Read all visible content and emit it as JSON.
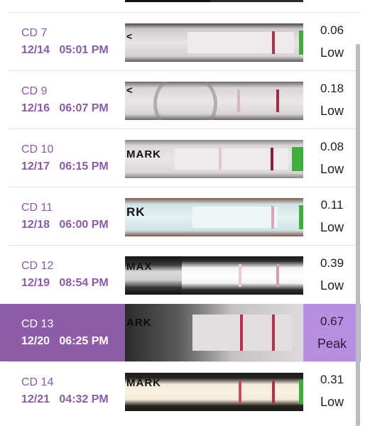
{
  "colors": {
    "accent": "#8e5ca8",
    "peak_value_bg": "#b88ee0",
    "text_purple": "#8a5aa5",
    "test_line": "#b8304f"
  },
  "readings": [
    {
      "cycle_day": "CD 7",
      "date": "12/14",
      "time": "05:01 PM",
      "value": "0.06",
      "level": "Low",
      "is_peak": false,
      "strip_mark_text": "",
      "strip_icon": "test-strip-photo"
    },
    {
      "cycle_day": "CD 9",
      "date": "12/16",
      "time": "06:07 PM",
      "value": "0.18",
      "level": "Low",
      "is_peak": false,
      "strip_mark_text": "",
      "strip_icon": "test-strip-photo"
    },
    {
      "cycle_day": "CD 10",
      "date": "12/17",
      "time": "06:15 PM",
      "value": "0.08",
      "level": "Low",
      "is_peak": false,
      "strip_mark_text": "MARK",
      "strip_icon": "test-strip-photo"
    },
    {
      "cycle_day": "CD 11",
      "date": "12/18",
      "time": "06:00 PM",
      "value": "0.11",
      "level": "Low",
      "is_peak": false,
      "strip_mark_text": "RK",
      "strip_icon": "test-strip-photo"
    },
    {
      "cycle_day": "CD 12",
      "date": "12/19",
      "time": "08:54 PM",
      "value": "0.39",
      "level": "Low",
      "is_peak": false,
      "strip_mark_text": "MAX",
      "strip_icon": "test-strip-photo"
    },
    {
      "cycle_day": "CD 13",
      "date": "12/20",
      "time": "06:25 PM",
      "value": "0.67",
      "level": "Peak",
      "is_peak": true,
      "strip_mark_text": "ARK",
      "strip_icon": "test-strip-photo"
    },
    {
      "cycle_day": "CD 14",
      "date": "12/21",
      "time": "04:32 PM",
      "value": "0.31",
      "level": "Low",
      "is_peak": false,
      "strip_mark_text": "MARK",
      "strip_icon": "test-strip-photo"
    }
  ]
}
